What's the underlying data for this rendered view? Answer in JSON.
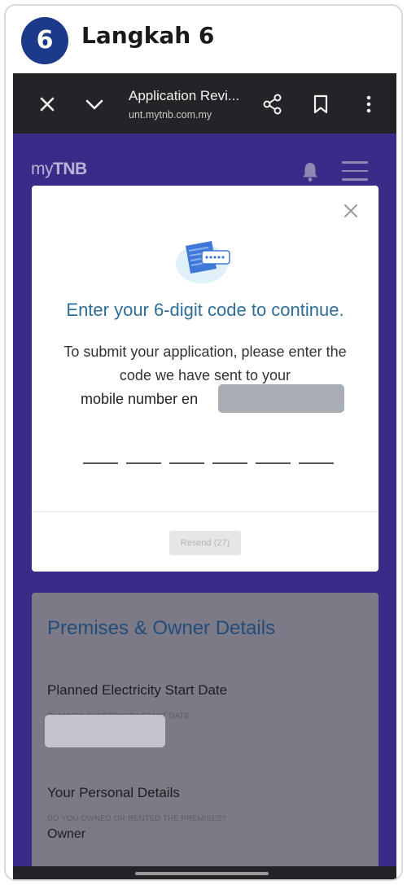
{
  "step": {
    "number": "6",
    "title": "Langkah 6"
  },
  "browser": {
    "page_title": "Application Revi...",
    "url": "unt.mytnb.com.my",
    "icons": [
      "close-icon",
      "chevron-down-icon",
      "share-icon",
      "bookmark-icon",
      "more-vert-icon"
    ]
  },
  "app": {
    "logo_light": "my",
    "logo_bold": "TNB",
    "icons": [
      "bell-icon",
      "menu-icon"
    ]
  },
  "modal": {
    "heading": "Enter your 6-digit code to continue.",
    "line1": "To submit your application, please enter the",
    "line2": "code we have sent to your",
    "line3": "mobile number en",
    "otp_digits": [
      "",
      "",
      "",
      "",
      "",
      ""
    ],
    "resend_label": "Resend (27)"
  },
  "background_card": {
    "title": "Premises & Owner Details",
    "start_date_label": "Planned Electricity Start Date",
    "start_date_caption": "PLANNED ELECTRICITY START DATE",
    "personal_label": "Your Personal Details",
    "owned_caption": "DO YOU OWNED OR RENTED THE PREMISES?",
    "owned_value": "Owner"
  },
  "colors": {
    "badge": "#1b3a8a",
    "app_bg": "#3b2a87",
    "heading": "#2f6e99",
    "browser_bar": "#232427"
  }
}
